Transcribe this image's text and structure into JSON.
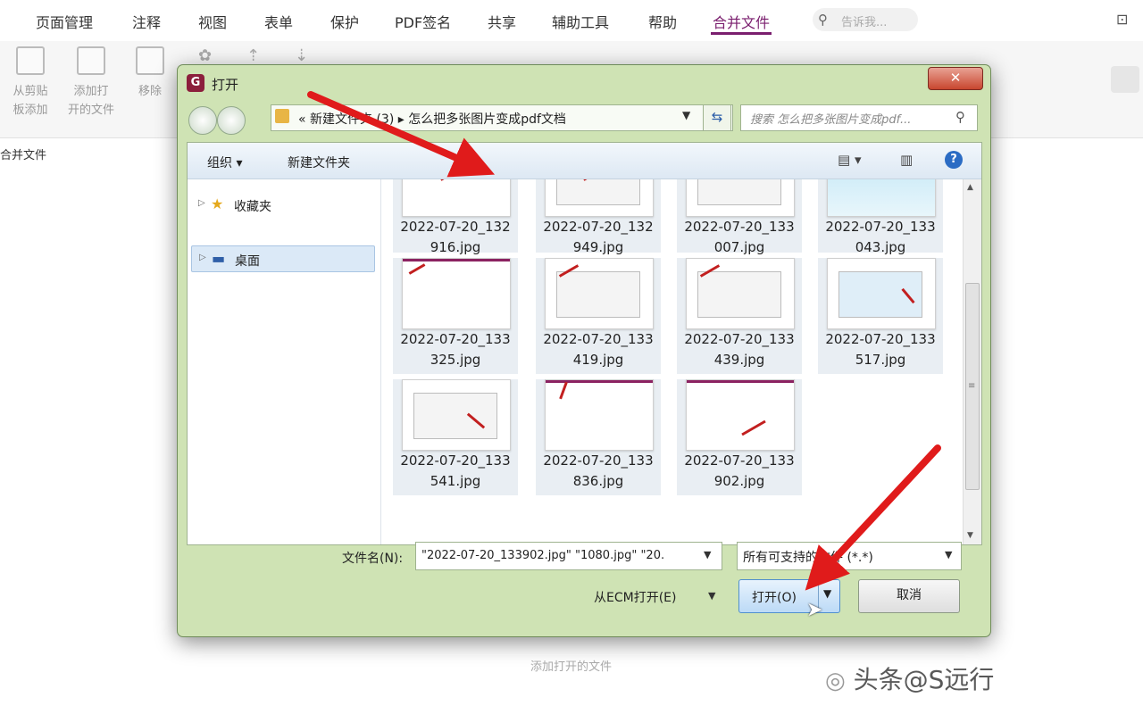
{
  "menu": {
    "items": [
      "页面管理",
      "注释",
      "视图",
      "表单",
      "保护",
      "PDF签名",
      "共享",
      "辅助工具",
      "帮助",
      "合并文件"
    ],
    "active_index": 9,
    "search_placeholder": "告诉我..."
  },
  "ribbon": {
    "buttons": [
      {
        "label": "从剪贴\n板添加",
        "icon": "clipboard-icon"
      },
      {
        "label": "添加打\n开的文件",
        "icon": "add-file-icon"
      },
      {
        "label": "移除",
        "icon": "trash-icon"
      }
    ]
  },
  "section_label": "合并文件",
  "bottom_hint": "添加打开的文件",
  "watermark": "头条@S远行",
  "dialog": {
    "title": "打开",
    "close_label": "✕",
    "breadcrumb": "«  新建文件夹 (3)  ▸  怎么把多张图片变成pdf文档",
    "search_placeholder": "搜索 怎么把多张图片变成pdf...",
    "toolbar": {
      "organize": "组织 ▾",
      "new_folder": "新建文件夹"
    },
    "nav": [
      {
        "label": "收藏夹",
        "icon": "star-icon",
        "selected": false
      },
      {
        "label": "桌面",
        "icon": "desktop-icon",
        "selected": true
      }
    ],
    "files": [
      {
        "name1": "2022-07-20_132",
        "name2": "916.jpg",
        "selected": true
      },
      {
        "name1": "2022-07-20_132",
        "name2": "949.jpg",
        "selected": true
      },
      {
        "name1": "2022-07-20_133",
        "name2": "007.jpg",
        "selected": true
      },
      {
        "name1": "2022-07-20_133",
        "name2": "043.jpg",
        "selected": true
      },
      {
        "name1": "2022-07-20_133",
        "name2": "325.jpg",
        "selected": true
      },
      {
        "name1": "2022-07-20_133",
        "name2": "419.jpg",
        "selected": true
      },
      {
        "name1": "2022-07-20_133",
        "name2": "439.jpg",
        "selected": true
      },
      {
        "name1": "2022-07-20_133",
        "name2": "517.jpg",
        "selected": true
      },
      {
        "name1": "2022-07-20_133",
        "name2": "541.jpg",
        "selected": true
      },
      {
        "name1": "2022-07-20_133",
        "name2": "836.jpg",
        "selected": true
      },
      {
        "name1": "2022-07-20_133",
        "name2": "902.jpg",
        "selected": true
      }
    ],
    "filename_label": "文件名(N):",
    "filename_value": "\"2022-07-20_133902.jpg\" \"1080.jpg\" \"20.",
    "filetype_value": "所有可支持的文件 (*.*)",
    "ecm_label": "从ECM打开(E)",
    "open_label": "打开(O)",
    "cancel_label": "取消"
  },
  "colors": {
    "accent": "#7a1e6e",
    "dialog_frame": "#cfe3b4",
    "arrow": "#e01b1b"
  }
}
